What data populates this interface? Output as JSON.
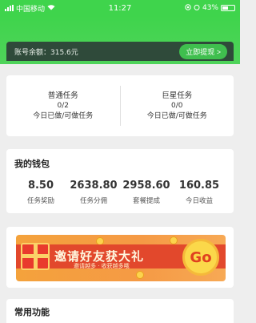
{
  "status_bar": {
    "carrier": "中国移动",
    "time": "11:27",
    "battery": "43%"
  },
  "balance": {
    "label": "账号余额：315.6元",
    "withdraw_label": "立即提现 >"
  },
  "tasks": [
    {
      "title": "普通任务",
      "count": "0/2",
      "desc": "今日已做/可做任务"
    },
    {
      "title": "巨星任务",
      "count": "0/0",
      "desc": "今日已做/可做任务"
    }
  ],
  "wallet": {
    "title": "我的钱包",
    "stats": [
      {
        "value": "8.50",
        "label": "任务奖励"
      },
      {
        "value": "2638.80",
        "label": "任务分佣"
      },
      {
        "value": "2958.60",
        "label": "套餐提成"
      },
      {
        "value": "160.85",
        "label": "今日收益"
      }
    ]
  },
  "banner": {
    "headline": "邀请好友获大礼",
    "subline": "邀请越多 · 收获越多哦",
    "go_label": "Go"
  },
  "common": {
    "title": "常用功能"
  },
  "colors": {
    "brand_green": "#3fd44c",
    "balance_bar": "#2f4a3a",
    "banner_orange": "#f5a03c",
    "banner_red": "#e2482c"
  }
}
